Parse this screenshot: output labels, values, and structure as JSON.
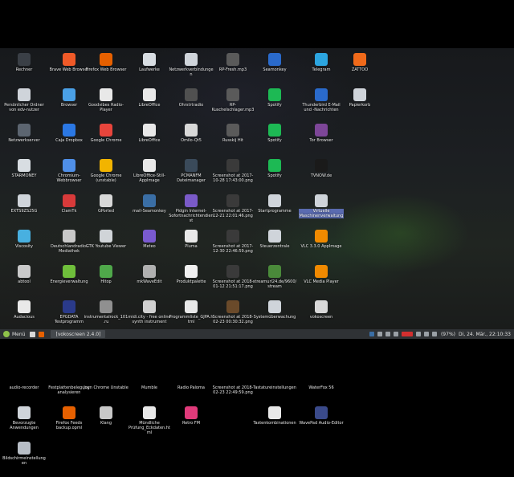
{
  "columns": [
    [
      {
        "label": "Rechner",
        "icon": "computer-icon",
        "color": "#3a3f46"
      },
      {
        "label": "Persönlicher Ordner von edv-nutzer",
        "icon": "home-icon",
        "color": "#cfd4da"
      },
      {
        "label": "Netzwerkserver",
        "icon": "network-server-icon",
        "color": "#5c6570"
      },
      {
        "label": "STARMONEY",
        "icon": "starmoney-icon",
        "color": "#d8dde2"
      },
      {
        "label": "EXTS9ZS25G",
        "icon": "drive-icon",
        "color": "#cfd4da"
      },
      {
        "label": "Viscosity",
        "icon": "viscosity-icon",
        "color": "#48b0e0"
      },
      {
        "label": "abtool",
        "icon": "abtool-icon",
        "color": "#c9c9c9"
      },
      {
        "label": "Audacious",
        "icon": "audacious-icon",
        "color": "#e9e9e9"
      },
      {
        "label": "Audacity",
        "icon": "audacity-icon",
        "color": "#2f62d8"
      },
      {
        "label": "audio-recorder",
        "icon": "microphone-icon",
        "color": "#5a7fc0"
      },
      {
        "label": "Bevorzugte Anwendungen",
        "icon": "preferred-apps-icon",
        "color": "#cfd4da"
      },
      {
        "label": "Bildschirmeinstellungen",
        "icon": "display-icon",
        "color": "#b8bec6"
      }
    ],
    [
      {
        "label": "Brave Web Browser",
        "icon": "brave-icon",
        "color": "#f05a28"
      },
      {
        "label": "Browser",
        "icon": "browser-globe-icon",
        "color": "#4aa0e6"
      },
      {
        "label": "Caja Dropbox",
        "icon": "dropbox-icon",
        "color": "#2b78e4"
      },
      {
        "label": "Chromium-Webbrowser",
        "icon": "chromium-icon",
        "color": "#4f8fe8"
      },
      {
        "label": "ClamTk",
        "icon": "clamtk-icon",
        "color": "#d83a3a"
      },
      {
        "label": "Deutschlandradio-Mediathek",
        "icon": "radio-icon",
        "color": "#c8c8c8"
      },
      {
        "label": "Energieverwaltung",
        "icon": "battery-icon",
        "color": "#6fbf3b"
      },
      {
        "label": "EPGDATA Testprogramm",
        "icon": "epg-icon",
        "color": "#2a3a8a"
      },
      {
        "label": "FB-Messenger",
        "icon": "messenger-icon",
        "color": "#1e88e5"
      },
      {
        "label": "Festplattenbelegung analysieren",
        "icon": "disk-usage-icon",
        "color": "#c8ccd0"
      },
      {
        "label": "Firefox Feeds backup.opml",
        "icon": "firefox-feeds-icon",
        "color": "#e66000"
      }
    ],
    [
      {
        "label": "Firefox Web Browser",
        "icon": "firefox-icon",
        "color": "#e66000"
      },
      {
        "label": "Goodvibes Radio-Player",
        "icon": "goodvibes-icon",
        "color": "#e8e8e8"
      },
      {
        "label": "Google Chrome",
        "icon": "chrome-icon",
        "color": "#e8453c"
      },
      {
        "label": "Google Chrome (unstable)",
        "icon": "chrome-unstable-icon",
        "color": "#f2b400"
      },
      {
        "label": "GPorted",
        "icon": "gparted-icon",
        "color": "#d8d8d8"
      },
      {
        "label": "GTK Youtube Viewer",
        "icon": "youtube-viewer-icon",
        "color": "#d0d4d8"
      },
      {
        "label": "Hitop",
        "icon": "hitop-icon",
        "color": "#4fa84a"
      },
      {
        "label": "instrumentalrock_101.ru",
        "icon": "radio-stream-icon",
        "color": "#909090"
      },
      {
        "label": "Joyn",
        "icon": "joyn-icon",
        "color": "#1a1a1a"
      },
      {
        "label": "Joyn Chrome Unstable",
        "icon": "joyn-chrome-icon",
        "color": "#1a1a1a"
      },
      {
        "label": "Klang",
        "icon": "sound-icon",
        "color": "#c8c8c8"
      }
    ],
    [
      {
        "label": "Laufwerke",
        "icon": "drives-icon",
        "color": "#d8dde2"
      },
      {
        "label": "LibreOffice",
        "icon": "libreoffice-icon",
        "color": "#e8e8e8"
      },
      {
        "label": "LibreOffice",
        "icon": "libreoffice-icon",
        "color": "#e8e8e8"
      },
      {
        "label": "LibreOffice-Still-AppImage",
        "icon": "libreoffice-appimage-icon",
        "color": "#e8e8e8"
      },
      {
        "label": "mail-Seamonkey",
        "icon": "seamonkey-mail-icon",
        "color": "#3a6ea5"
      },
      {
        "label": "Meteo",
        "icon": "meteo-icon",
        "color": "#7a5ad0"
      },
      {
        "label": "mkWaveEdit",
        "icon": "wave-edit-icon",
        "color": "#b0b0b0"
      },
      {
        "label": "midi.city - free online synth instrument",
        "icon": "midi-icon",
        "color": "#d0d0d0"
      },
      {
        "label": "MixPad Musikstudio-Software",
        "icon": "mixpad-icon",
        "color": "#d44"
      },
      {
        "label": "Mumble",
        "icon": "mumble-icon",
        "color": "#e0e0e0"
      },
      {
        "label": "Mündliche Prüfung_Eckdaten.html",
        "icon": "html-file-icon",
        "color": "#e8e8e8"
      }
    ],
    [
      {
        "label": "Netzwerkverbindungen",
        "icon": "network-connections-icon",
        "color": "#cfd4da"
      },
      {
        "label": "Ohrstrtradio",
        "icon": "radio-icon",
        "color": "#505050"
      },
      {
        "label": "Omilo-Qt5",
        "icon": "webcam-icon",
        "color": "#d8d8d8"
      },
      {
        "label": "PCMANFM Dateimanager",
        "icon": "file-manager-icon",
        "color": "#3a4a5a"
      },
      {
        "label": "Pidgin Internet-Sofortnachrichtendienst",
        "icon": "pidgin-icon",
        "color": "#7a5ac8"
      },
      {
        "label": "Pluma",
        "icon": "pluma-icon",
        "color": "#e8e8e8"
      },
      {
        "label": "Produktpalette",
        "icon": "palette-icon",
        "color": "#f0f0f0"
      },
      {
        "label": "Programmliste_GJPA.html",
        "icon": "html-file-icon",
        "color": "#e8e8e8"
      },
      {
        "label": "Radio Dacha",
        "icon": "radio-dacha-icon",
        "color": "#2a6acb"
      },
      {
        "label": "Radio Paloma",
        "icon": "radio-paloma-icon",
        "color": "#e8e8e8"
      },
      {
        "label": "Retro FM",
        "icon": "retro-fm-icon",
        "color": "#e03a7a"
      }
    ],
    [
      {
        "label": "RP-Fresh.mp3",
        "icon": "mp3-file-icon",
        "color": "#5a5a5a"
      },
      {
        "label": "RP-Kuschelschlager.mp3",
        "icon": "mp3-file-icon",
        "color": "#5a5a5a"
      },
      {
        "label": "Russkij Hit",
        "icon": "radio-icon",
        "color": "#5a5a5a"
      },
      {
        "label": "Screenshot at 2017-10-28 17:43:00.png",
        "icon": "image-file-icon",
        "color": "#3a3a3a"
      },
      {
        "label": "Screenshot at 2017-12-21 22:01:46.png",
        "icon": "image-file-icon",
        "color": "#3a3a3a"
      },
      {
        "label": "Screenshot at 2017-12-30 22:46:59.png",
        "icon": "image-file-icon",
        "color": "#3a3a3a"
      },
      {
        "label": "Screenshot at 2018-01-12 21:51:17.png",
        "icon": "image-file-icon",
        "color": "#3a3a3a"
      },
      {
        "label": "Screenshot at 2018-02-23 00:30:32.png",
        "icon": "image-file-icon",
        "color": "#6a4a2a"
      },
      {
        "label": "Screenshot at 2018-02-23 19:43:19.png",
        "icon": "image-file-icon",
        "color": "#6a4a2a"
      },
      {
        "label": "Screenshot at 2018-02-23 22:49:59.png",
        "icon": "image-file-icon",
        "color": "#6a4a2a"
      }
    ],
    [
      {
        "label": "Seamonkey",
        "icon": "seamonkey-icon",
        "color": "#2a6acb"
      },
      {
        "label": "Spotify",
        "icon": "spotify-icon",
        "color": "#1db954"
      },
      {
        "label": "Spotify",
        "icon": "spotify-icon",
        "color": "#1db954"
      },
      {
        "label": "Spotify",
        "icon": "spotify-icon",
        "color": "#1db954"
      },
      {
        "label": "Startprogramme",
        "icon": "startup-icon",
        "color": "#cfd4da"
      },
      {
        "label": "Steuerzentrale",
        "icon": "control-center-icon",
        "color": "#cfd4da"
      },
      {
        "label": "streamurl24.de/9600/stream",
        "icon": "stream-icon",
        "color": "#4a8a3a"
      },
      {
        "label": "Systemüberwachung",
        "icon": "system-monitor-icon",
        "color": "#cfd4da"
      },
      {
        "label": "Taschenrechner",
        "icon": "calculator-icon",
        "color": "#e8e8e8"
      },
      {
        "label": "Tastatureinstellungen",
        "icon": "keyboard-icon",
        "color": "#e8e8e8"
      },
      {
        "label": "Tastenkombinationen",
        "icon": "shortcuts-icon",
        "color": "#e8e8e8"
      }
    ],
    [
      {
        "label": "Telegram",
        "icon": "telegram-icon",
        "color": "#2ca5e0"
      },
      {
        "label": "Thunderbird E-Mail und -Nachrichten",
        "icon": "thunderbird-icon",
        "color": "#2a6acb"
      },
      {
        "label": "Tor Browser",
        "icon": "tor-icon",
        "color": "#7d4698"
      },
      {
        "label": "TVNOW.de",
        "icon": "tvnow-icon",
        "color": "#1a1a1a"
      },
      {
        "label": "Virtuelle Maschinenverwaltung",
        "icon": "virt-manager-icon",
        "color": "#cfd4da",
        "selected": true
      },
      {
        "label": "VLC 3.3.0 AppImage",
        "icon": "vlc-icon",
        "color": "#f08a00"
      },
      {
        "label": "VLC Media Player",
        "icon": "vlc-icon",
        "color": "#f08a00"
      },
      {
        "label": "vokoscreen",
        "icon": "vokoscreen-icon",
        "color": "#d8d8d8"
      },
      {
        "label": "Waipu.tv - Fernsehen wie noch nie",
        "icon": "waipu-icon",
        "color": "#2a6acb"
      },
      {
        "label": "WaterFox 56",
        "icon": "waterfox-icon",
        "color": "#2a8acb"
      },
      {
        "label": "WavePad Audio-Editor",
        "icon": "wavepad-icon",
        "color": "#3a4a8a"
      }
    ],
    [
      {
        "label": "ZATTOO",
        "icon": "zattoo-icon",
        "color": "#f06a1a"
      },
      {
        "label": "Papierkorb",
        "icon": "trash-icon",
        "color": "#cfd4da"
      }
    ]
  ],
  "taskbar": {
    "menu_label": "Menü",
    "window_label": "[vokoscreen 2.4.0]",
    "battery": "(97%)",
    "clock": "Di, 24. Mär., 22:10:33"
  }
}
